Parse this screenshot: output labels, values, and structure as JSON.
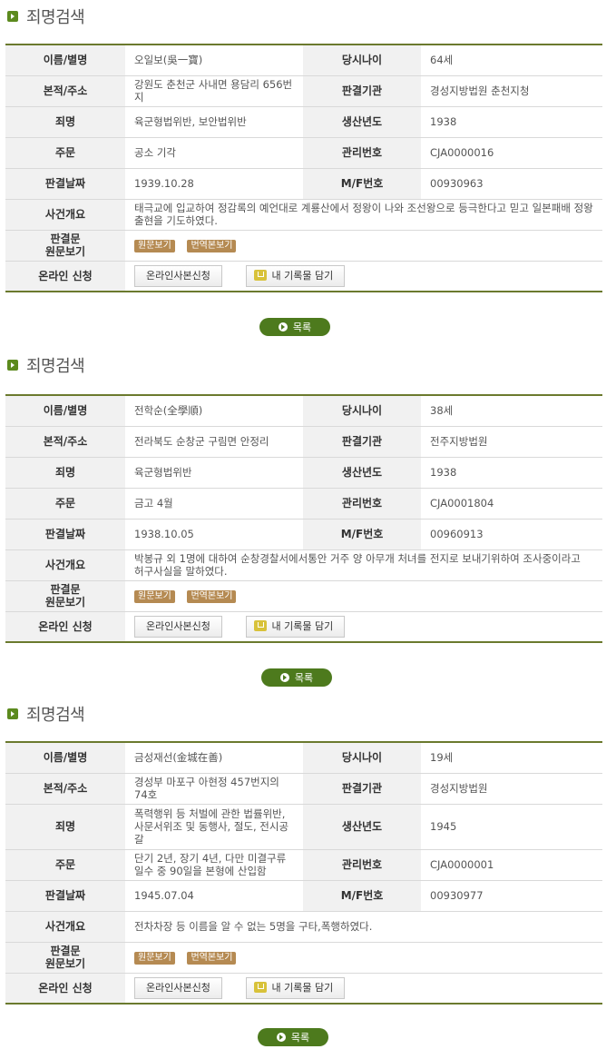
{
  "records": [
    {
      "section_title": "죄명검색",
      "labels": {
        "name": "이름/별명",
        "age": "당시나이",
        "address": "본적/주소",
        "court": "판결기관",
        "crime": "죄명",
        "birth_year": "생산년도",
        "sentence": "주문",
        "mgmt_no": "관리번호",
        "date": "판결날짜",
        "mf_no": "M/F번호",
        "summary": "사건개요",
        "judgment": "판결문\n원문보기",
        "online": "온라인 신청"
      },
      "name": "오일보(吳一寶)",
      "age": "64세",
      "address": "강원도 춘천군 사내면 용담리 656번지",
      "court": "경성지방법원 춘천지청",
      "crime": "육군형법위반, 보안법위반",
      "birth_year": "1938",
      "sentence": "공소 기각",
      "mgmt_no": "CJA0000016",
      "date": "1939.10.28",
      "mf_no": "00930963",
      "summary": "태극교에 입교하여 정감록의 예언대로 계룡산에서 정왕이 나와 조선왕으로 등극한다고 믿고 일본패배 정왕출현을 기도하였다.",
      "btn_original": "원문보기",
      "btn_translation": "번역본보기",
      "btn_copy": "온라인사본신청",
      "btn_cart": "내 기록물 담기",
      "list_label": "목록"
    },
    {
      "section_title": "죄명검색",
      "labels": {
        "name": "이름/별명",
        "age": "당시나이",
        "address": "본적/주소",
        "court": "판결기관",
        "crime": "죄명",
        "birth_year": "생산년도",
        "sentence": "주문",
        "mgmt_no": "관리번호",
        "date": "판결날짜",
        "mf_no": "M/F번호",
        "summary": "사건개요",
        "judgment": "판결문\n원문보기",
        "online": "온라인 신청"
      },
      "name": "전학순(全學順)",
      "age": "38세",
      "address": "전라북도 순창군 구림면 안정리",
      "court": "전주지방법원",
      "crime": "육군형법위반",
      "birth_year": "1938",
      "sentence": "금고 4월",
      "mgmt_no": "CJA0001804",
      "date": "1938.10.05",
      "mf_no": "00960913",
      "summary": "박봉규 외 1명에 대하여 순창경찰서에서통안 거주 양 아무개 처녀를 전지로 보내기위하여 조사중이라고 허구사실을 말하였다.",
      "btn_original": "원문보기",
      "btn_translation": "번역본보기",
      "btn_copy": "온라인사본신청",
      "btn_cart": "내 기록물 담기",
      "list_label": "목록"
    },
    {
      "section_title": "죄명검색",
      "labels": {
        "name": "이름/별명",
        "age": "당시나이",
        "address": "본적/주소",
        "court": "판결기관",
        "crime": "죄명",
        "birth_year": "생산년도",
        "sentence": "주문",
        "mgmt_no": "관리번호",
        "date": "판결날짜",
        "mf_no": "M/F번호",
        "summary": "사건개요",
        "judgment": "판결문\n원문보기",
        "online": "온라인 신청"
      },
      "name": "금성재선(金城在善)",
      "age": "19세",
      "address": "경성부 마포구 아현정 457번지의 74호",
      "court": "경성지방법원",
      "crime": "폭력행위 등 처벌에 관한 법률위반, 사문서위조 및 동행사, 절도, 전시공갈",
      "birth_year": "1945",
      "sentence": "단기 2년, 장기 4년, 다만 미결구류일수 중 90일을 본형에 산입함",
      "mgmt_no": "CJA0000001",
      "date": "1945.07.04",
      "mf_no": "00930977",
      "summary": "전차차장 등 이름을 알 수 없는 5명을 구타,폭행하였다.",
      "btn_original": "원문보기",
      "btn_translation": "번역본보기",
      "btn_copy": "온라인사본신청",
      "btn_cart": "내 기록물 담기",
      "list_label": "목록"
    }
  ]
}
